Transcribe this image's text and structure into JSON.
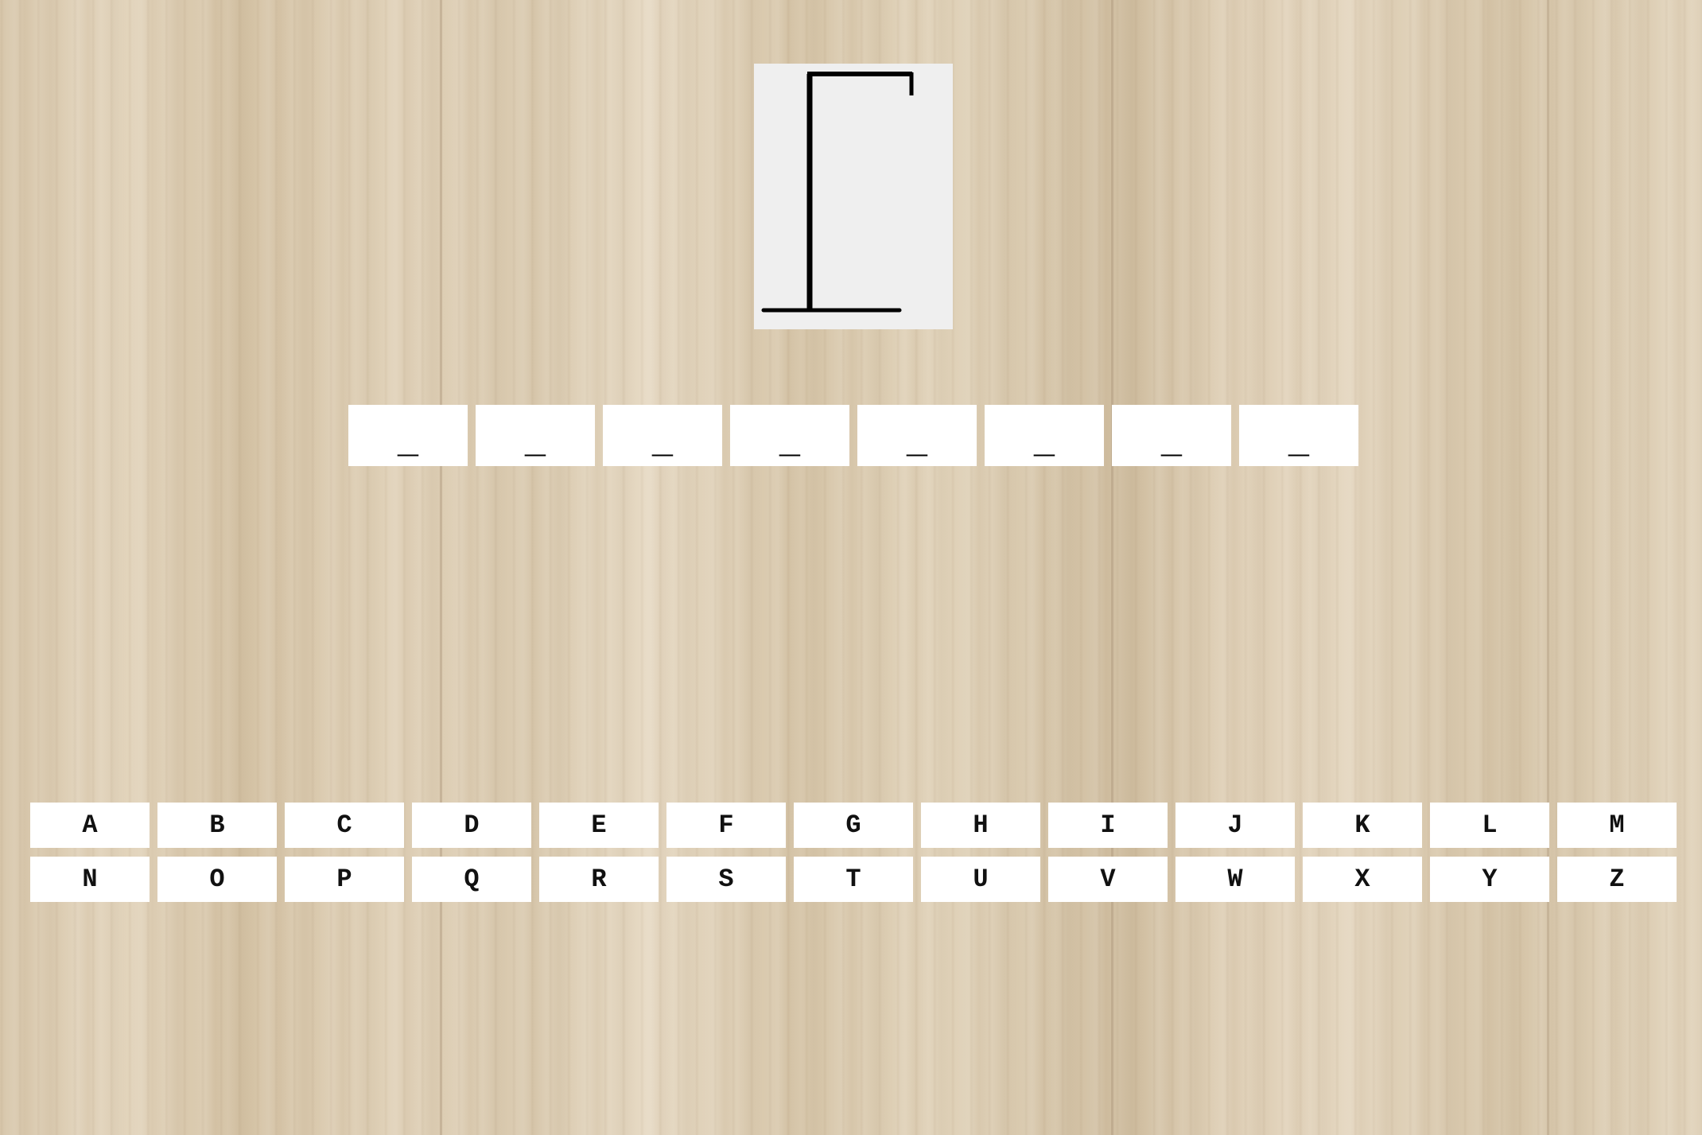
{
  "game": {
    "wrong_guesses": 0,
    "word_length": 8
  },
  "word_slots": [
    "_",
    "_",
    "_",
    "_",
    "_",
    "_",
    "_",
    "_"
  ],
  "keyboard": {
    "row1": [
      "A",
      "B",
      "C",
      "D",
      "E",
      "F",
      "G",
      "H",
      "I",
      "J",
      "K",
      "L",
      "M"
    ],
    "row2": [
      "N",
      "O",
      "P",
      "Q",
      "R",
      "S",
      "T",
      "U",
      "V",
      "W",
      "X",
      "Y",
      "Z"
    ]
  },
  "colors": {
    "background": "#dccdb4",
    "card": "#efefef",
    "tile": "#ffffff",
    "ink": "#000000"
  }
}
